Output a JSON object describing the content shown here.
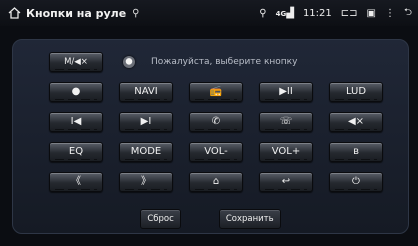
{
  "statusbar": {
    "title": "Кнопки на руле",
    "time": "11:21",
    "network": "4G"
  },
  "panel": {
    "mode_button": "M/◀×",
    "hint": "Пожалуйста, выберите кнопку"
  },
  "buttons": [
    {
      "name": "disc-button",
      "label": "●"
    },
    {
      "name": "navi-button",
      "label": "NAVI"
    },
    {
      "name": "radio-button",
      "label": "📻"
    },
    {
      "name": "play-pause-button",
      "label": "▶II"
    },
    {
      "name": "lud-button",
      "label": "LUD"
    },
    {
      "name": "prev-track-button",
      "label": "I◀"
    },
    {
      "name": "next-track-button",
      "label": "▶I"
    },
    {
      "name": "call-button",
      "label": "✆"
    },
    {
      "name": "hangup-button",
      "label": "☏"
    },
    {
      "name": "mute-button",
      "label": "◀×"
    },
    {
      "name": "eq-button",
      "label": "EQ"
    },
    {
      "name": "mode-button",
      "label": "MODE"
    },
    {
      "name": "vol-down-button",
      "label": "VOL-"
    },
    {
      "name": "vol-up-button",
      "label": "VOL+"
    },
    {
      "name": "bluetooth-button",
      "label": "ʙ"
    },
    {
      "name": "rewind-button",
      "label": "《"
    },
    {
      "name": "fast-forward-button",
      "label": "》"
    },
    {
      "name": "home-button",
      "label": "⌂"
    },
    {
      "name": "back-button",
      "label": "↩"
    },
    {
      "name": "power-button",
      "label": "⏻"
    }
  ],
  "actions": {
    "reset": "Сброс",
    "save": "Сохранить"
  }
}
